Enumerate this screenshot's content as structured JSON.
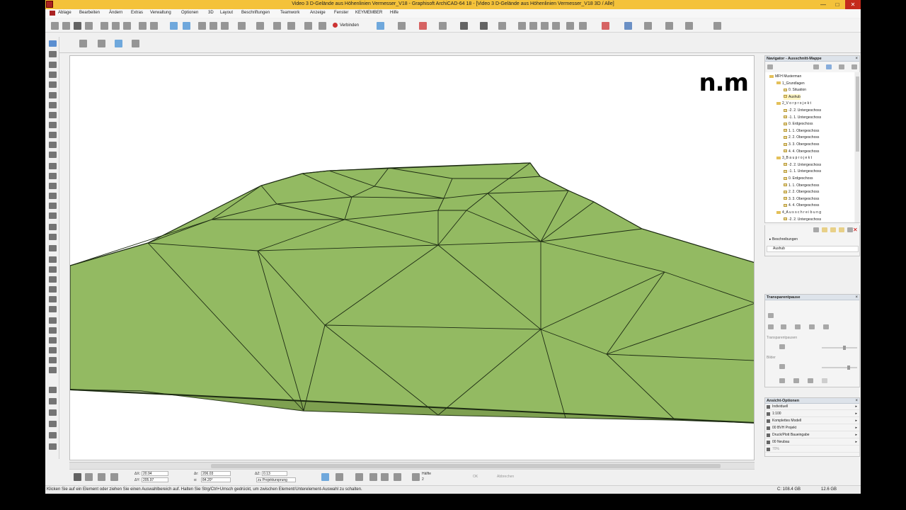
{
  "window": {
    "title": "Video 3 D-Gelände aus Höhenlinien Vermesser_V18 - Graphisoft ArchiCAD-64 18 - [Video 3 D-Gelände aus Höhenlinien Vermesser_V18 3D / Alle]",
    "minimize": "—",
    "maximize": "□",
    "close": "✕"
  },
  "menu": [
    "Ablage",
    "Bearbeiten",
    "Ändern",
    "Extras",
    "Verwaltung",
    "Optionen",
    "3D",
    "Layout",
    "Beschriftungen",
    "Teamwork",
    "Anzeige",
    "Fenster",
    "KEYMEMBER",
    "Hilfe"
  ],
  "toolbar": {
    "connect_label": "Verbinden"
  },
  "viewport": {
    "logo": "n.m"
  },
  "navigator": {
    "title": "Navigator - Ausschnitt-Mappe",
    "items": [
      {
        "label": "MFH Musterman",
        "level": 0,
        "kind": "root"
      },
      {
        "label": "1_Grundlagen",
        "level": 1,
        "kind": "folder"
      },
      {
        "label": "0. Situation",
        "level": 2,
        "kind": "view"
      },
      {
        "label": "Aushub",
        "level": 2,
        "kind": "view",
        "selected": true
      },
      {
        "label": "2_V o r p r o j e k t",
        "level": 1,
        "kind": "folder"
      },
      {
        "label": "-2. 2. Untergeschoss",
        "level": 2,
        "kind": "view"
      },
      {
        "label": "-1. 1. Untergeschoss",
        "level": 2,
        "kind": "view"
      },
      {
        "label": "0. Erdgeschoss",
        "level": 2,
        "kind": "view"
      },
      {
        "label": "1. 1. Obergeschoss",
        "level": 2,
        "kind": "view"
      },
      {
        "label": "2. 2. Obergeschoss",
        "level": 2,
        "kind": "view"
      },
      {
        "label": "3. 3. Obergeschoss",
        "level": 2,
        "kind": "view"
      },
      {
        "label": "4. 4. Obergeschoss",
        "level": 2,
        "kind": "view"
      },
      {
        "label": "3_B a u p r o j e k t",
        "level": 1,
        "kind": "folder"
      },
      {
        "label": "-2. 2. Untergeschoss",
        "level": 2,
        "kind": "view"
      },
      {
        "label": "-1. 1. Untergeschoss",
        "level": 2,
        "kind": "view"
      },
      {
        "label": "0. Erdgeschoss",
        "level": 2,
        "kind": "view"
      },
      {
        "label": "1. 1. Obergeschoss",
        "level": 2,
        "kind": "view"
      },
      {
        "label": "2. 2. Obergeschoss",
        "level": 2,
        "kind": "view"
      },
      {
        "label": "3. 3. Obergeschoss",
        "level": 2,
        "kind": "view"
      },
      {
        "label": "4. 4. Obergeschoss",
        "level": 2,
        "kind": "view"
      },
      {
        "label": "4_A u s s c h r e i b u n g",
        "level": 1,
        "kind": "folder"
      },
      {
        "label": "-2. 2. Untergeschoss",
        "level": 2,
        "kind": "view"
      }
    ]
  },
  "description": {
    "header": "Beschreibungen",
    "value": "Aushub"
  },
  "transparency": {
    "title": "Transparentpause",
    "label1": "Transparentpausen",
    "label2": "Bilder"
  },
  "view_options": {
    "title": "Ansicht-Optionen",
    "rows": [
      "Individuell",
      "1:100",
      "Komplettes Modell",
      "00 BVH Projekt",
      "Druck/Plott Baueingabe",
      "00 Neubau",
      "70%"
    ]
  },
  "infobox": {
    "dx_label": "ΔX:",
    "dx": "20.94",
    "dy_label": "ΔY:",
    "dy": "205.97",
    "dr_label": "Δr:",
    "dr": "206.03",
    "angle_label": "α:",
    "angle": "84.20°",
    "dz_label": "ΔZ:",
    "dz": "0.13",
    "ref": "zu Projektursprung",
    "snap": "Hälfte",
    "snap_value": "2",
    "ok": "OK",
    "cancel": "Abbrechen"
  },
  "status": {
    "hint": "Klicken Sie auf ein Element oder ziehen Sie einen Auswahlbereich auf. Halten Sie Strg/Ctrl+Umsch gedrückt, um zwischen Element/Unterelement-Auswahl zu schalten.",
    "disk_c": "C: 108.4 GB",
    "ram": "12.6 GB"
  },
  "colors": {
    "terrain": "#93ba62",
    "terrain_edge": "#1c2a12",
    "title_bar": "#f4c23a"
  }
}
